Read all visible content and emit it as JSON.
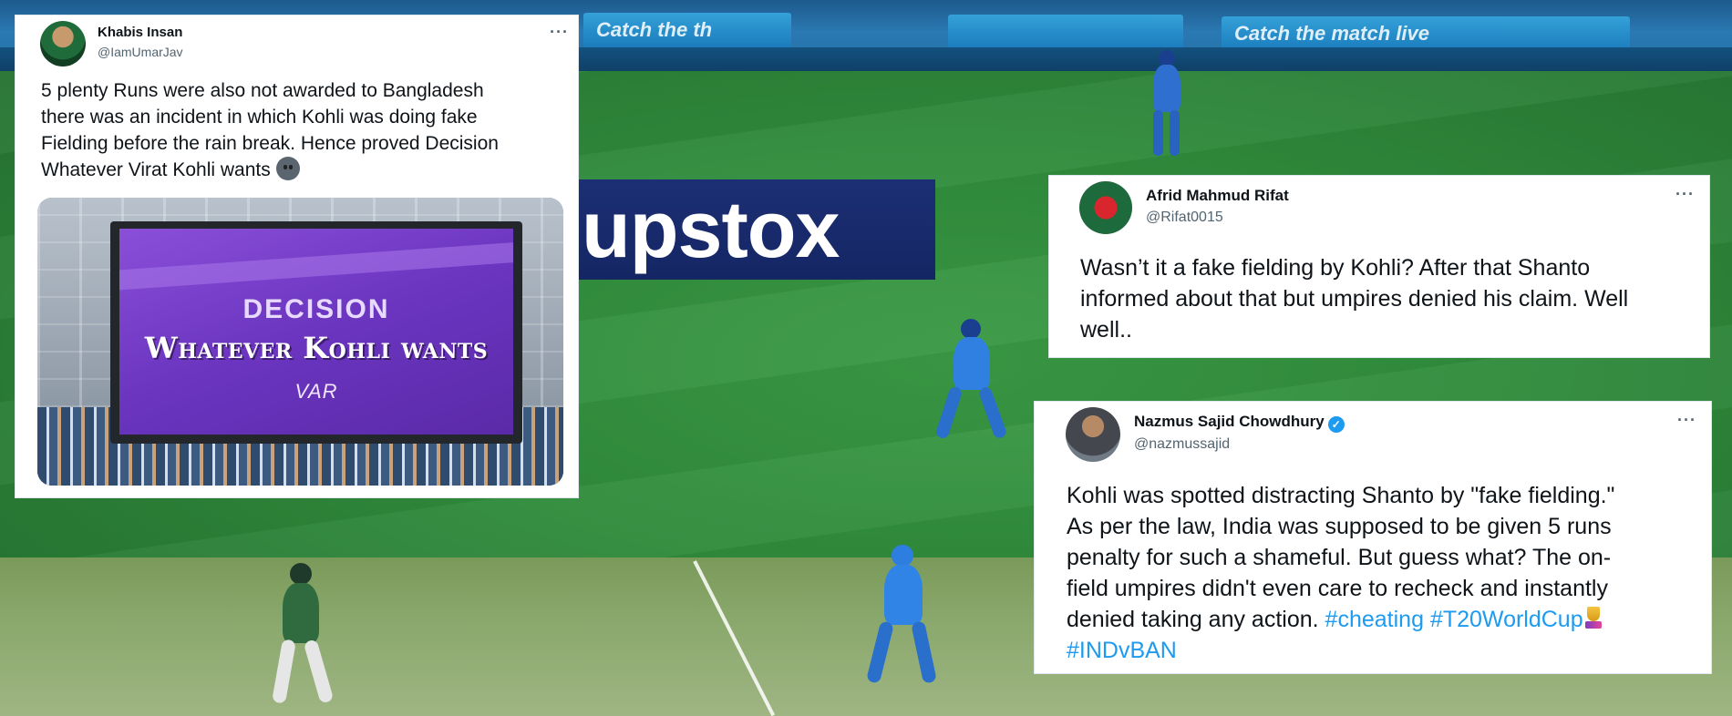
{
  "background": {
    "board_texts": [
      "Catch the th",
      "Catch the match live"
    ],
    "sponsor": "upstox"
  },
  "tweets": [
    {
      "name": "Khabis Insan",
      "handle": "@IamUmarJav",
      "more": "···",
      "lines": [
        "5 plenty Runs were also not awarded to Bangladesh",
        "there was an incident in which Kohli was doing fake",
        "Fielding before the rain break. Hence proved Decision",
        "Whatever Virat Kohli wants"
      ],
      "emoji": "neutral-face-emoji",
      "media": {
        "decision": "DECISION",
        "verdict": "Whatever Kohli wants",
        "logo": "VAR"
      }
    },
    {
      "name": "Afrid Mahmud Rifat",
      "handle": "@Rifat0015",
      "more": "···",
      "lines": [
        "Wasn’t it a fake fielding by Kohli? After that Shanto",
        "informed about that but umpires denied his claim. Well",
        "well.."
      ]
    },
    {
      "name": "Nazmus Sajid Chowdhury",
      "handle": "@nazmussajid",
      "verified_icon": "verified-badge-icon",
      "more": "···",
      "lines": [
        "Kohli was spotted distracting Shanto by \"fake fielding.\"",
        "As per the law, India was supposed to be given 5 runs",
        "penalty for such a shameful. But guess what? The on-",
        "field umpires didn't even care to recheck and instantly",
        "denied taking any action."
      ],
      "hashtags": [
        "#cheating",
        "#T20WorldCup",
        "#INDvBAN"
      ]
    }
  ],
  "colors": {
    "hashtag": "#1d9bf0",
    "verified": "#1d9bf0",
    "pitch_green": "#2f8a3b"
  }
}
